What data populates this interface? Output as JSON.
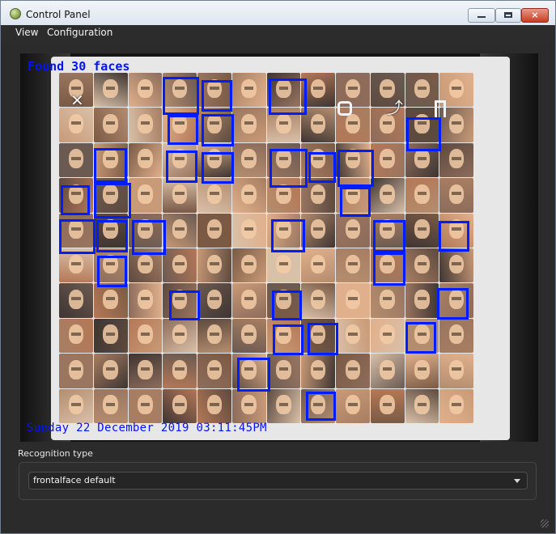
{
  "window": {
    "title": "Control Panel",
    "controls": {
      "minimize_icon": "minimize-icon",
      "maximize_icon": "maximize-icon",
      "close_icon": "close-icon"
    }
  },
  "menu": {
    "items": [
      {
        "label": "View"
      },
      {
        "label": "Configuration"
      }
    ]
  },
  "video": {
    "found_text": "Found 30 faces",
    "timestamp": "Sunday 22 December 2019 03:11:45PM",
    "overlay_color": "#001dff",
    "overlay_icons": [
      "close-icon",
      "lens-icon",
      "share-icon",
      "bookmark-icon"
    ]
  },
  "recognition": {
    "label": "Recognition type",
    "selected": "frontalface default"
  },
  "colors": {
    "window_bg": "#2b2b2b",
    "panel_bg": "#2d2d2d",
    "detection_box": "#001dff",
    "text": "#f2f2f2"
  }
}
